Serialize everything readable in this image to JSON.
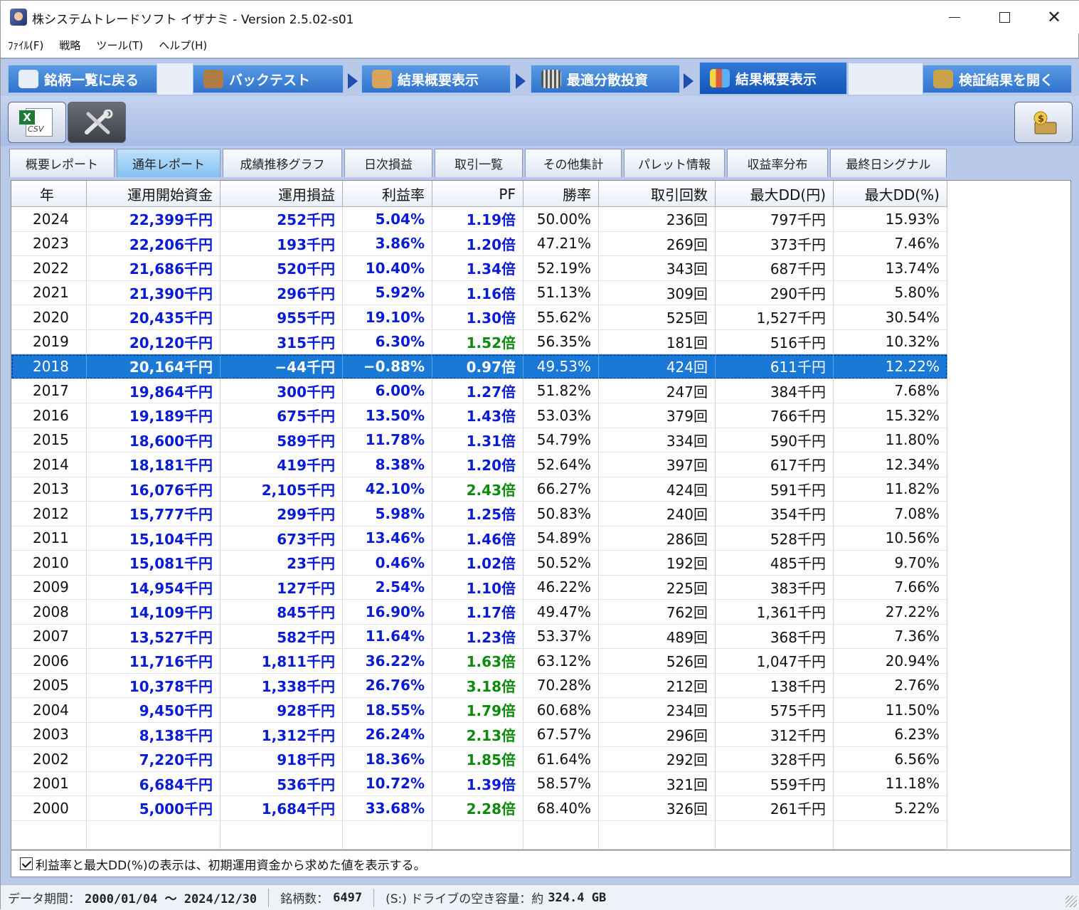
{
  "window": {
    "title": "株システムトレードソフト イザナミ - Version 2.5.02-s01",
    "icon": "app-icon"
  },
  "menu": [
    "ﾌｧｲﾙ(F)",
    "戦略",
    "ツール(T)",
    "ヘルプ(H)"
  ],
  "nav_tabs": [
    {
      "label": "銘柄一覧に戻る",
      "icon": "eye-icon"
    },
    {
      "label": "バックテスト",
      "icon": "bag-icon"
    },
    {
      "label": "結果概要表示",
      "icon": "hand-chart-icon"
    },
    {
      "label": "最適分散投資",
      "icon": "grid-icon"
    },
    {
      "label": "結果概要表示",
      "icon": "bar-chart-icon"
    },
    {
      "label": "検証結果を開く",
      "icon": "open-results-icon"
    }
  ],
  "toolbar": {
    "csv_label": "CSV"
  },
  "report_tabs": [
    "概要レポート",
    "通年レポート",
    "成績推移グラフ",
    "日次損益",
    "取引一覧",
    "その他集計",
    "パレット情報",
    "収益率分布",
    "最終日シグナル"
  ],
  "active_report_tab": "通年レポート",
  "table": {
    "headers": [
      "年",
      "運用開始資金",
      "運用損益",
      "利益率",
      "PF",
      "勝率",
      "取引回数",
      "最大DD(円)",
      "最大DD(%)"
    ],
    "selected_year": "2018",
    "rows": [
      {
        "year": "2024",
        "start": "22,399千円",
        "pnl": "252千円",
        "rate": "5.04%",
        "pf": "1.19倍",
        "win": "50.00%",
        "trades": "236回",
        "dd_yen": "797千円",
        "dd_pct": "15.93%",
        "pf_color": "blue"
      },
      {
        "year": "2023",
        "start": "22,206千円",
        "pnl": "193千円",
        "rate": "3.86%",
        "pf": "1.20倍",
        "win": "47.21%",
        "trades": "269回",
        "dd_yen": "373千円",
        "dd_pct": "7.46%",
        "pf_color": "blue"
      },
      {
        "year": "2022",
        "start": "21,686千円",
        "pnl": "520千円",
        "rate": "10.40%",
        "pf": "1.34倍",
        "win": "52.19%",
        "trades": "343回",
        "dd_yen": "687千円",
        "dd_pct": "13.74%",
        "pf_color": "blue"
      },
      {
        "year": "2021",
        "start": "21,390千円",
        "pnl": "296千円",
        "rate": "5.92%",
        "pf": "1.16倍",
        "win": "51.13%",
        "trades": "309回",
        "dd_yen": "290千円",
        "dd_pct": "5.80%",
        "pf_color": "blue"
      },
      {
        "year": "2020",
        "start": "20,435千円",
        "pnl": "955千円",
        "rate": "19.10%",
        "pf": "1.30倍",
        "win": "55.62%",
        "trades": "525回",
        "dd_yen": "1,527千円",
        "dd_pct": "30.54%",
        "pf_color": "blue"
      },
      {
        "year": "2019",
        "start": "20,120千円",
        "pnl": "315千円",
        "rate": "6.30%",
        "pf": "1.52倍",
        "win": "56.35%",
        "trades": "181回",
        "dd_yen": "516千円",
        "dd_pct": "10.32%",
        "pf_color": "green"
      },
      {
        "year": "2018",
        "start": "20,164千円",
        "pnl": "−44千円",
        "rate": "−0.88%",
        "pf": "0.97倍",
        "win": "49.53%",
        "trades": "424回",
        "dd_yen": "611千円",
        "dd_pct": "12.22%",
        "pf_color": "blue"
      },
      {
        "year": "2017",
        "start": "19,864千円",
        "pnl": "300千円",
        "rate": "6.00%",
        "pf": "1.27倍",
        "win": "51.82%",
        "trades": "247回",
        "dd_yen": "384千円",
        "dd_pct": "7.68%",
        "pf_color": "blue"
      },
      {
        "year": "2016",
        "start": "19,189千円",
        "pnl": "675千円",
        "rate": "13.50%",
        "pf": "1.43倍",
        "win": "53.03%",
        "trades": "379回",
        "dd_yen": "766千円",
        "dd_pct": "15.32%",
        "pf_color": "blue"
      },
      {
        "year": "2015",
        "start": "18,600千円",
        "pnl": "589千円",
        "rate": "11.78%",
        "pf": "1.31倍",
        "win": "54.79%",
        "trades": "334回",
        "dd_yen": "590千円",
        "dd_pct": "11.80%",
        "pf_color": "blue"
      },
      {
        "year": "2014",
        "start": "18,181千円",
        "pnl": "419千円",
        "rate": "8.38%",
        "pf": "1.20倍",
        "win": "52.64%",
        "trades": "397回",
        "dd_yen": "617千円",
        "dd_pct": "12.34%",
        "pf_color": "blue"
      },
      {
        "year": "2013",
        "start": "16,076千円",
        "pnl": "2,105千円",
        "rate": "42.10%",
        "pf": "2.43倍",
        "win": "66.27%",
        "trades": "424回",
        "dd_yen": "591千円",
        "dd_pct": "11.82%",
        "pf_color": "green"
      },
      {
        "year": "2012",
        "start": "15,777千円",
        "pnl": "299千円",
        "rate": "5.98%",
        "pf": "1.25倍",
        "win": "50.83%",
        "trades": "240回",
        "dd_yen": "354千円",
        "dd_pct": "7.08%",
        "pf_color": "blue"
      },
      {
        "year": "2011",
        "start": "15,104千円",
        "pnl": "673千円",
        "rate": "13.46%",
        "pf": "1.46倍",
        "win": "54.89%",
        "trades": "286回",
        "dd_yen": "528千円",
        "dd_pct": "10.56%",
        "pf_color": "blue"
      },
      {
        "year": "2010",
        "start": "15,081千円",
        "pnl": "23千円",
        "rate": "0.46%",
        "pf": "1.02倍",
        "win": "50.52%",
        "trades": "192回",
        "dd_yen": "485千円",
        "dd_pct": "9.70%",
        "pf_color": "blue"
      },
      {
        "year": "2009",
        "start": "14,954千円",
        "pnl": "127千円",
        "rate": "2.54%",
        "pf": "1.10倍",
        "win": "46.22%",
        "trades": "225回",
        "dd_yen": "383千円",
        "dd_pct": "7.66%",
        "pf_color": "blue"
      },
      {
        "year": "2008",
        "start": "14,109千円",
        "pnl": "845千円",
        "rate": "16.90%",
        "pf": "1.17倍",
        "win": "49.47%",
        "trades": "762回",
        "dd_yen": "1,361千円",
        "dd_pct": "27.22%",
        "pf_color": "blue"
      },
      {
        "year": "2007",
        "start": "13,527千円",
        "pnl": "582千円",
        "rate": "11.64%",
        "pf": "1.23倍",
        "win": "53.37%",
        "trades": "489回",
        "dd_yen": "368千円",
        "dd_pct": "7.36%",
        "pf_color": "blue"
      },
      {
        "year": "2006",
        "start": "11,716千円",
        "pnl": "1,811千円",
        "rate": "36.22%",
        "pf": "1.63倍",
        "win": "63.12%",
        "trades": "526回",
        "dd_yen": "1,047千円",
        "dd_pct": "20.94%",
        "pf_color": "green"
      },
      {
        "year": "2005",
        "start": "10,378千円",
        "pnl": "1,338千円",
        "rate": "26.76%",
        "pf": "3.18倍",
        "win": "70.28%",
        "trades": "212回",
        "dd_yen": "138千円",
        "dd_pct": "2.76%",
        "pf_color": "green"
      },
      {
        "year": "2004",
        "start": "9,450千円",
        "pnl": "928千円",
        "rate": "18.55%",
        "pf": "1.79倍",
        "win": "60.68%",
        "trades": "234回",
        "dd_yen": "575千円",
        "dd_pct": "11.50%",
        "pf_color": "green"
      },
      {
        "year": "2003",
        "start": "8,138千円",
        "pnl": "1,312千円",
        "rate": "26.24%",
        "pf": "2.13倍",
        "win": "67.57%",
        "trades": "296回",
        "dd_yen": "312千円",
        "dd_pct": "6.23%",
        "pf_color": "green"
      },
      {
        "year": "2002",
        "start": "7,220千円",
        "pnl": "918千円",
        "rate": "18.36%",
        "pf": "1.85倍",
        "win": "61.64%",
        "trades": "292回",
        "dd_yen": "328千円",
        "dd_pct": "6.56%",
        "pf_color": "green"
      },
      {
        "year": "2001",
        "start": "6,684千円",
        "pnl": "536千円",
        "rate": "10.72%",
        "pf": "1.39倍",
        "win": "58.57%",
        "trades": "321回",
        "dd_yen": "559千円",
        "dd_pct": "11.18%",
        "pf_color": "blue"
      },
      {
        "year": "2000",
        "start": "5,000千円",
        "pnl": "1,684千円",
        "rate": "33.68%",
        "pf": "2.28倍",
        "win": "68.40%",
        "trades": "326回",
        "dd_yen": "261千円",
        "dd_pct": "5.22%",
        "pf_color": "green"
      }
    ]
  },
  "checkbox": {
    "checked": true,
    "label": "利益率と最大DD(%)の表示は、初期運用資金から求めた値を表示する。"
  },
  "status": {
    "period_label": "データ期間：",
    "period_value": "2000/01/04 〜 2024/12/30",
    "count_label": "銘柄数：",
    "count_value": "6497",
    "drive_label": "(S:) ドライブの空き容量：約",
    "drive_value": "324.4 GB"
  },
  "colors": {
    "frame": "#b9c9ea",
    "nav_tab": "#3f84d9",
    "selected_row": "#1a78d7",
    "value_blue": "#0a1bd6",
    "value_green": "#0b8a0b"
  }
}
